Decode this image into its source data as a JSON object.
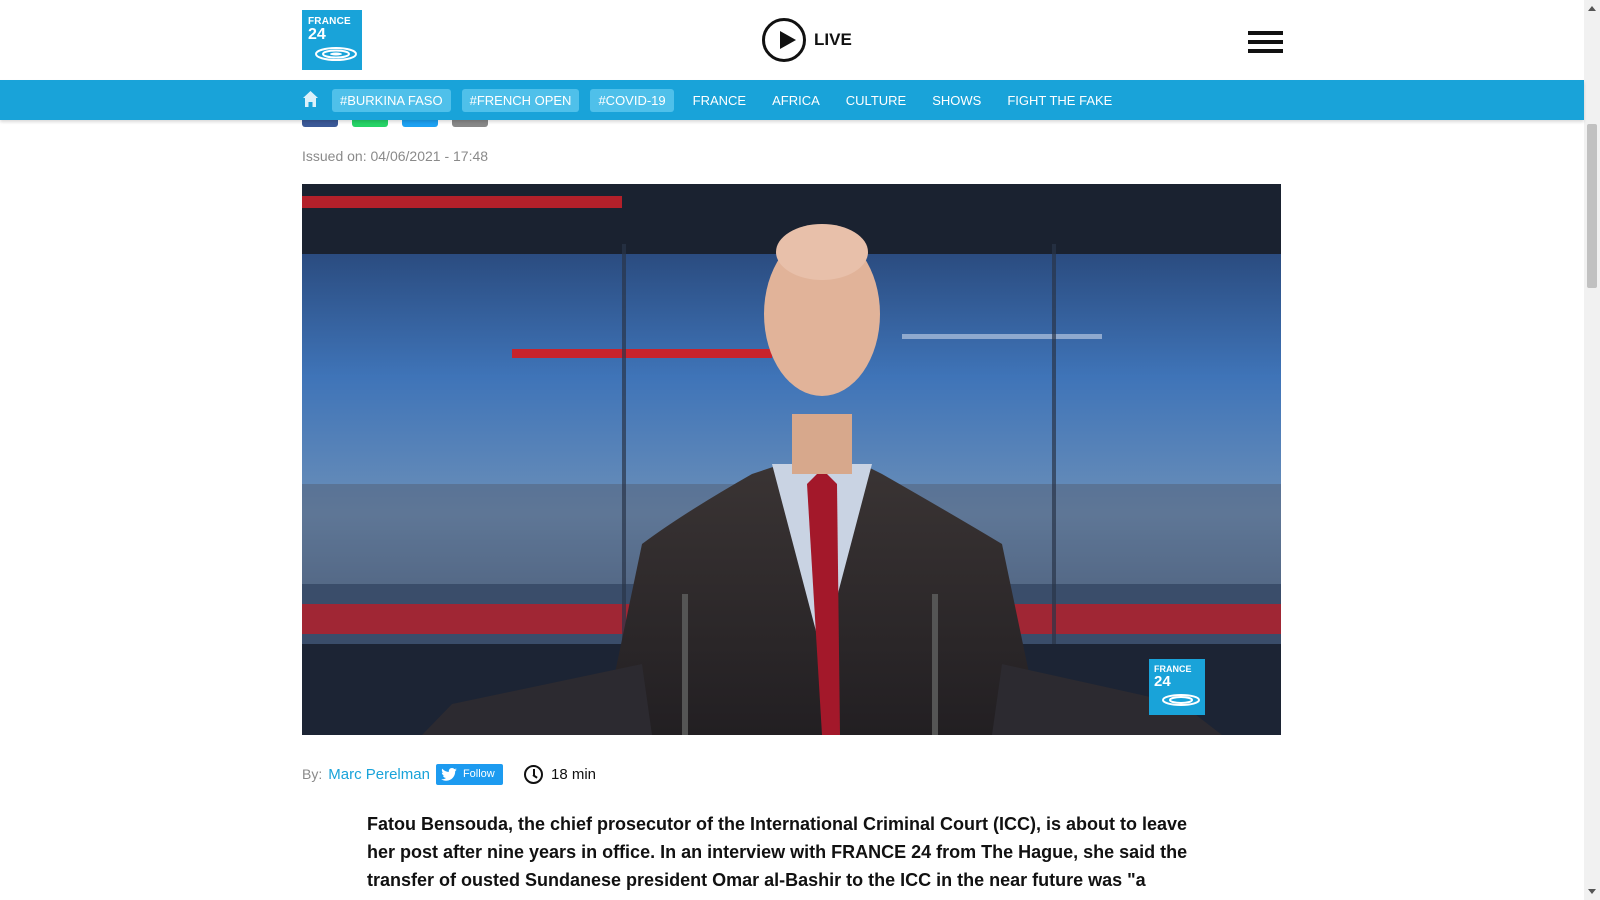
{
  "header": {
    "logo_line1": "FRANCE",
    "logo_line2": "24",
    "live_label": "LIVE"
  },
  "nav": {
    "tags": [
      "#BURKINA FASO",
      "#FRENCH OPEN",
      "#COVID-19"
    ],
    "links": [
      "FRANCE",
      "AFRICA",
      "CULTURE",
      "SHOWS",
      "FIGHT THE FAKE"
    ]
  },
  "article": {
    "issued": "Issued on: 04/06/2021 - 17:48",
    "by_label": "By:",
    "author": "Marc Perelman",
    "follow_label": "Follow",
    "read_time": "18 min",
    "lead": "Fatou Bensouda, the chief prosecutor of the International Criminal Court (ICC), is about to leave her post after nine years in office. In an interview with FRANCE 24 from The Hague, she said the transfer of ousted Sundanese president Omar al-Bashir to the ICC in the near future was \"a"
  },
  "video": {
    "logo_line1": "FRANCE",
    "logo_line2": "24"
  },
  "colors": {
    "brand_blue": "#19a3d9",
    "tag_bg": "#4fc0ea",
    "twitter_blue": "#1d9bf0"
  },
  "icons": [
    "play-icon",
    "hamburger-icon",
    "home-icon",
    "twitter-bird-icon",
    "clock-icon"
  ]
}
